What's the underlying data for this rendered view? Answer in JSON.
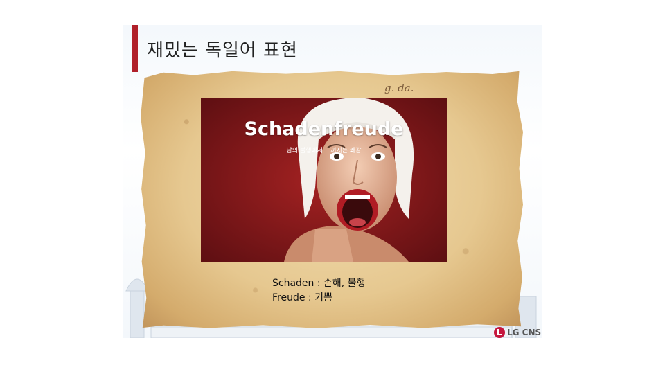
{
  "slide": {
    "title": "재밌는 독일어 표현",
    "scribble": "g. da.",
    "photo": {
      "headline": "Schadenfreude",
      "subheadline": "남의 불행에서 느끼지는 쾌감"
    },
    "caption": {
      "line1": "Schaden : 손해, 불행",
      "line2": "Freude : 기쁨"
    },
    "logo_text": "LG CNS"
  },
  "colors": {
    "accent": "#b0202a",
    "paper": "#e6c890",
    "photo_background": "#8e1a1c",
    "logo_red": "#c5163d"
  },
  "icons": [
    "lg-logo-icon",
    "woman-photo"
  ]
}
